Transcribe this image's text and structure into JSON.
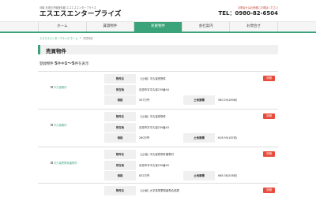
{
  "header": {
    "tagline": "沖縄 石垣島不動産情報 エスエスエンタープライズ",
    "logo": "エスエスエンタープライズ",
    "note": "お問合せはお気軽にお電話ください",
    "tel": "TEL：0980-82-6504"
  },
  "nav": [
    {
      "label": "ホーム",
      "active": false
    },
    {
      "label": "賃貸物件",
      "active": false
    },
    {
      "label": "売買物件",
      "active": true
    },
    {
      "label": "会社案内",
      "active": false
    },
    {
      "label": "お問合せ",
      "active": false
    }
  ],
  "breadcrumb": {
    "home": "エスエスエンタープライズ ホーム",
    "sep": ">",
    "current": "売買物件"
  },
  "page_title": "売買物件",
  "count": {
    "prefix": "登録物件",
    "total": "5",
    "mid": "件中",
    "range": "1〜5",
    "suffix": "件を表示"
  },
  "labels": {
    "name": "物件名",
    "location": "所在地",
    "price": "価格",
    "land_area": "土地面積",
    "detail": "詳細"
  },
  "listings": [
    {
      "thumb": "平久保物件",
      "name": "【土地】平久保売物件",
      "location": "石垣市字平久保239番44",
      "price": "507万円",
      "land_area": "580.59(169坪)"
    },
    {
      "thumb": "平久保物件",
      "name": "【土地】平久保売物件",
      "location": "石垣市字平久保239番43",
      "price": "260万円",
      "land_area": "618.95(187坪)"
    },
    {
      "thumb": "平久保売物件建物付",
      "name": "【土地】平久保売物件建物付",
      "location": "石垣市字平久保239番49",
      "price": "832万円",
      "land_area": "688.38(208坪)"
    },
    {
      "thumb": "",
      "name": "【土地】大字真栄里嘴者寿合前原",
      "location": "",
      "price": "",
      "land_area": ""
    }
  ],
  "colors": {
    "accent": "#3aa37a",
    "button": "#e74c3c"
  }
}
